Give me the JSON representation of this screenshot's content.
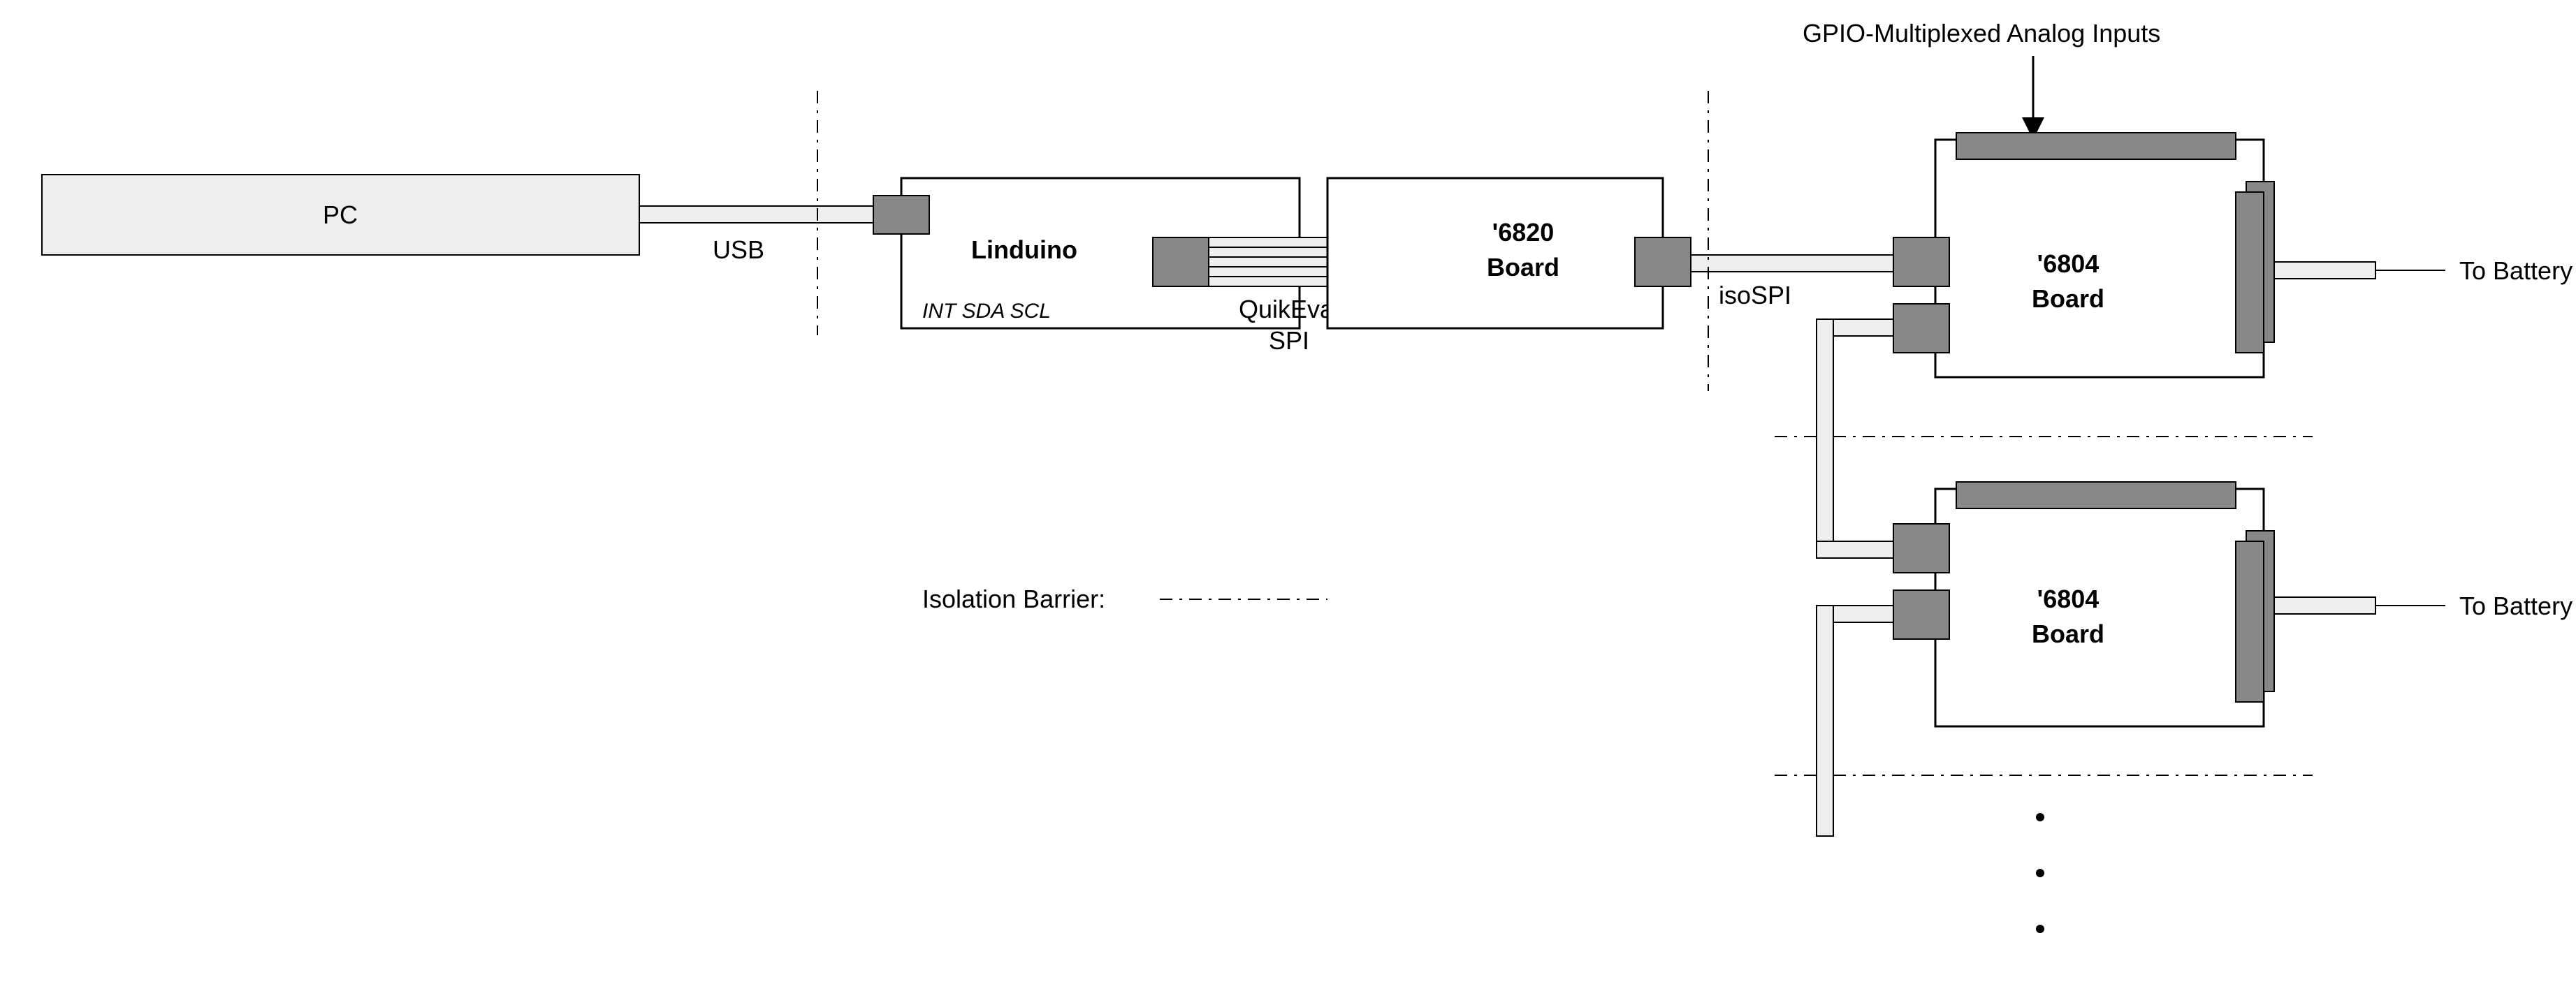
{
  "title": "GPIO-Multiplexed Analog Inputs",
  "blocks": {
    "pc": "PC",
    "linduino": "Linduino",
    "linduino_pins": "INT   SDA   SCL",
    "board6820_l1": "'6820",
    "board6820_l2": "Board",
    "board6804_l1": "'6804",
    "board6804_l2": "Board"
  },
  "labels": {
    "usb": "USB",
    "quikeval_l1": "QuikEval",
    "quikeval_l2": "SPI",
    "isospi": "isoSPI",
    "to_battery": "To Battery",
    "isolation": "Isolation Barrier:"
  }
}
